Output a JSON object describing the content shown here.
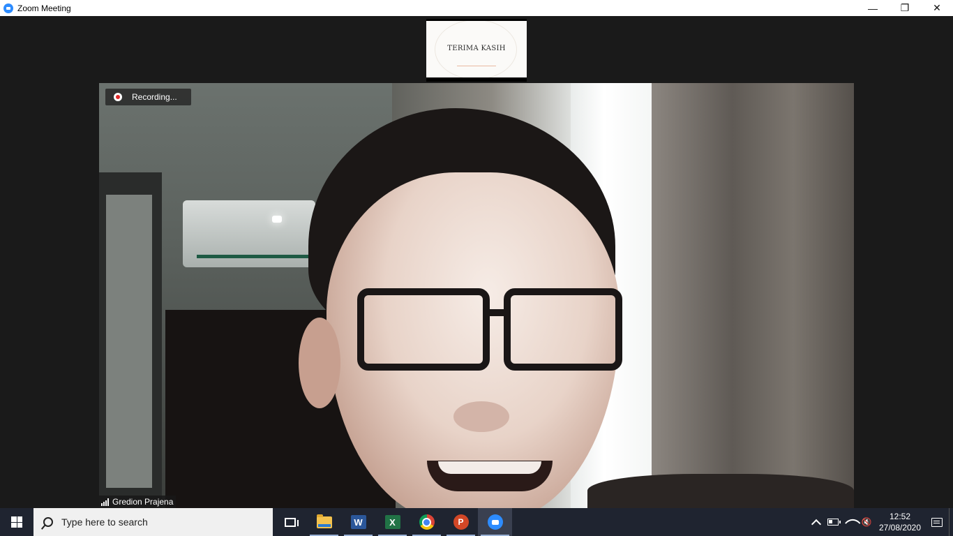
{
  "window": {
    "title": "Zoom Meeting",
    "controls": {
      "minimize": "—",
      "restore": "❐",
      "close": "✕"
    }
  },
  "meeting": {
    "shared_thumbnail_text": "TERIMA KASIH",
    "recording_label": "Recording...",
    "participant_name": "Gredion Prajena"
  },
  "taskbar": {
    "search_placeholder": "Type here to search",
    "apps": [
      "task-view",
      "file-explorer",
      "word",
      "excel",
      "chrome",
      "powerpoint",
      "zoom"
    ],
    "word_letter": "W",
    "excel_letter": "X",
    "ppt_letter": "P",
    "time": "12:52",
    "date": "27/08/2020",
    "mute_glyph": "🔇"
  },
  "colors": {
    "zoom_blue": "#2d8cff",
    "taskbar": "#1f2430",
    "recording_red": "#e02828"
  }
}
